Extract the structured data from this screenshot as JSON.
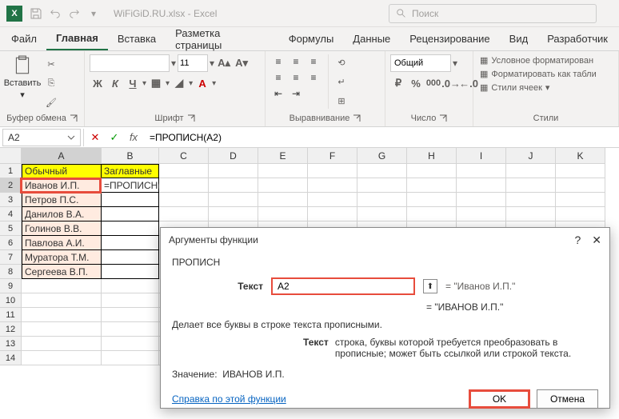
{
  "titlebar": {
    "filename": "WiFiGiD.RU.xlsx",
    "appname": "Excel",
    "sep": "-"
  },
  "search": {
    "placeholder": "Поиск"
  },
  "tabs": [
    "Файл",
    "Главная",
    "Вставка",
    "Разметка страницы",
    "Формулы",
    "Данные",
    "Рецензирование",
    "Вид",
    "Разработчик"
  ],
  "ribbon": {
    "paste": "Вставить",
    "clipboard": "Буфер обмена",
    "font": "Шрифт",
    "alignment": "Выравнивание",
    "number": "Число",
    "styles": "Стили",
    "font_size": "11",
    "num_format": "Общий",
    "cond_fmt": "Условное форматирован",
    "as_table": "Форматировать как табли",
    "cell_styles": "Стили ячеек"
  },
  "formula_bar": {
    "name_box": "A2",
    "formula": "=ПРОПИСН(A2)",
    "cancel": "✕",
    "enter": "✓",
    "fx": "fx"
  },
  "cols": {
    "widths": {
      "A": 100,
      "B": 72,
      "C": 62,
      "D": 62,
      "E": 62,
      "F": 62,
      "G": 62,
      "H": 62,
      "I": 62,
      "J": 62,
      "K": 62
    }
  },
  "rows": [
    "1",
    "2",
    "3",
    "4",
    "5",
    "6",
    "7",
    "8",
    "9",
    "10",
    "11",
    "12",
    "13",
    "14"
  ],
  "cells": {
    "A1": "Обычный",
    "B1": "Заглавные",
    "A2": "Иванов И.П.",
    "B2": "=ПРОПИСН(A2)",
    "A3": "Петров П.С.",
    "A4": "Данилов В.А.",
    "A5": "Голинов В.В.",
    "A6": "Павлова А.И.",
    "A7": "Муратора Т.М.",
    "A8": "Сергеева В.П."
  },
  "dialog": {
    "title": "Аргументы функции",
    "help": "?",
    "close": "✕",
    "fn": "ПРОПИСН",
    "arg_label": "Текст",
    "arg_value": "A2",
    "eval1": "= \"Иванов И.П.\"",
    "eval2": "= \"ИВАНОВ И.П.\"",
    "desc": "Делает все буквы в строке текста прописными.",
    "arg_desc_label": "Текст",
    "arg_desc": "строка, буквы которой требуется преобразовать в прописные; может быть ссылкой или строкой текста.",
    "value_label": "Значение:",
    "value": "ИВАНОВ И.П.",
    "help_link": "Справка по этой функции",
    "ok": "OK",
    "cancel": "Отмена"
  }
}
